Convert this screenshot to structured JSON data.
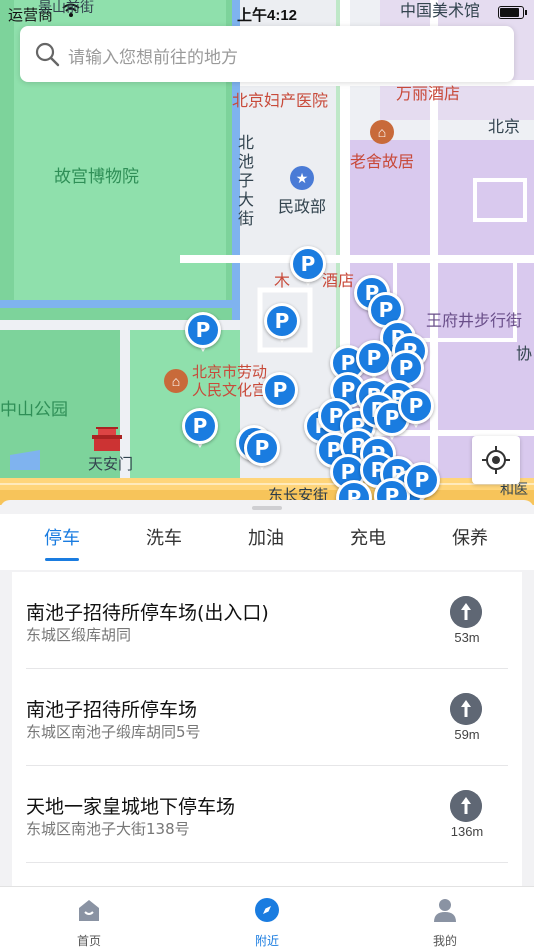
{
  "status_bar": {
    "carrier": "运营商",
    "time": "上午4:12",
    "battery_level": 0.9
  },
  "search": {
    "placeholder": "请输入您想前往的地方"
  },
  "map": {
    "labels": {
      "palace": "故宫博物院",
      "zhongshan": "中山公园",
      "tiananmen": "天安门",
      "fuchan": "北京妇产医院",
      "nanchizi_street": "北池子大街",
      "minzheng": "民政部",
      "laoshe": "老舍故居",
      "wanli": "万丽酒店",
      "wangfujing": "王府井步行街",
      "laodong": "北京市劳动人民文化宫",
      "changan": "东长安街",
      "meishuguan": "中国美术馆",
      "mu_hotel": "木",
      "hotel_suffix": "酒店",
      "beijing_right": "北京",
      "xie": "协",
      "he": "和医",
      "top_cut": "景山前街"
    },
    "pin_label": "P",
    "colors": {
      "pin": "#1a7ce0",
      "palace_green": "#7dd39b",
      "purple_zone": "#d9c9ee"
    }
  },
  "sheet": {
    "tabs": [
      {
        "label": "停车",
        "active": true
      },
      {
        "label": "洗车",
        "active": false
      },
      {
        "label": "加油",
        "active": false
      },
      {
        "label": "充电",
        "active": false
      },
      {
        "label": "保养",
        "active": false
      }
    ],
    "items": [
      {
        "title": "南池子招待所停车场(出入口)",
        "address": "东城区缎库胡同",
        "distance": "53m"
      },
      {
        "title": "南池子招待所停车场",
        "address": "东城区南池子缎库胡同5号",
        "distance": "59m"
      },
      {
        "title": "天地一家皇城地下停车场",
        "address": "东城区南池子大街138号",
        "distance": "136m"
      }
    ]
  },
  "tabbar": {
    "items": [
      {
        "label": "首页",
        "icon": "home-icon",
        "active": false
      },
      {
        "label": "附近",
        "icon": "compass-icon",
        "active": true
      },
      {
        "label": "我的",
        "icon": "user-icon",
        "active": false
      }
    ]
  }
}
